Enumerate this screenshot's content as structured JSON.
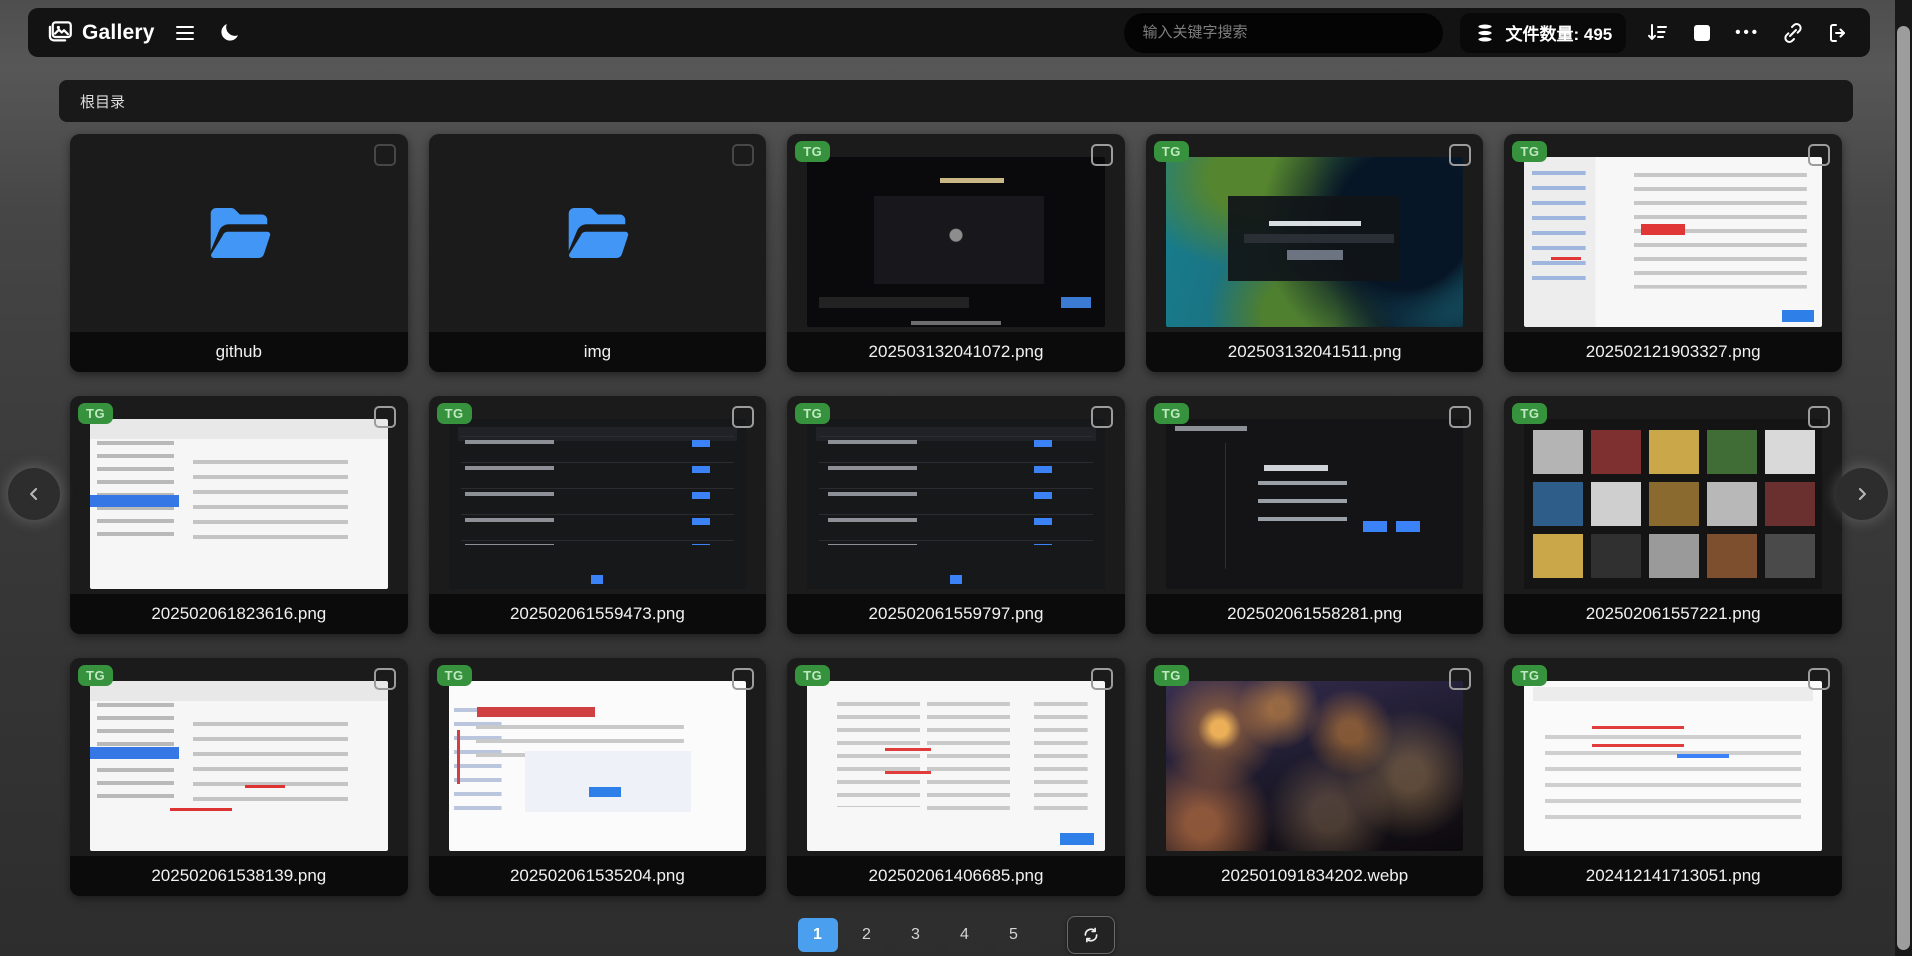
{
  "header": {
    "app_title": "Gallery",
    "search_placeholder": "输入关键字搜索",
    "file_count_label": "文件数量: 495",
    "more_label": "•••",
    "icons": {
      "logo": "gallery-images-icon",
      "menu": "hamburger-icon",
      "theme": "moon-icon",
      "count": "database-icon",
      "sort": "sort-descending-icon",
      "select": "square-icon",
      "more": "ellipsis-icon",
      "link": "chain-link-icon",
      "logout": "sign-out-icon"
    }
  },
  "breadcrumb": {
    "path": "根目录"
  },
  "grid": {
    "items": [
      {
        "type": "folder",
        "label": "github"
      },
      {
        "type": "folder",
        "label": "img"
      },
      {
        "type": "image",
        "label": "202503132041072.png",
        "badge": "TG",
        "thumb": "sanyue-dark"
      },
      {
        "type": "image",
        "label": "202503132041511.png",
        "badge": "TG",
        "thumb": "coast-login"
      },
      {
        "type": "image",
        "label": "202502121903327.png",
        "badge": "TG",
        "thumb": "light-doc-a"
      },
      {
        "type": "image",
        "label": "202502061823616.png",
        "badge": "TG",
        "thumb": "light-settings-a"
      },
      {
        "type": "image",
        "label": "202502061559473.png",
        "badge": "TG",
        "thumb": "dark-table-a"
      },
      {
        "type": "image",
        "label": "202502061559797.png",
        "badge": "TG",
        "thumb": "dark-table-b"
      },
      {
        "type": "image",
        "label": "202502061558281.png",
        "badge": "TG",
        "thumb": "dark-dialog"
      },
      {
        "type": "image",
        "label": "202502061557221.png",
        "badge": "TG",
        "thumb": "gallery-grid"
      },
      {
        "type": "image",
        "label": "202502061538139.png",
        "badge": "TG",
        "thumb": "light-settings-b"
      },
      {
        "type": "image",
        "label": "202502061535204.png",
        "badge": "TG",
        "thumb": "light-doc-b"
      },
      {
        "type": "image",
        "label": "202502061406685.png",
        "badge": "TG",
        "thumb": "light-doc-c"
      },
      {
        "type": "image",
        "label": "202501091834202.webp",
        "badge": "TG",
        "thumb": "anime-night"
      },
      {
        "type": "image",
        "label": "202412141713051.png",
        "badge": "TG",
        "thumb": "light-doc-d"
      }
    ]
  },
  "pagination": {
    "pages": [
      "1",
      "2",
      "3",
      "4",
      "5"
    ],
    "active": "1"
  },
  "colors": {
    "accent_blue": "#4aa0ee",
    "badge_green": "#37923d",
    "folder_blue": "#4196f6",
    "card_bg": "#1b1b1b",
    "header_bg": "#131313"
  }
}
